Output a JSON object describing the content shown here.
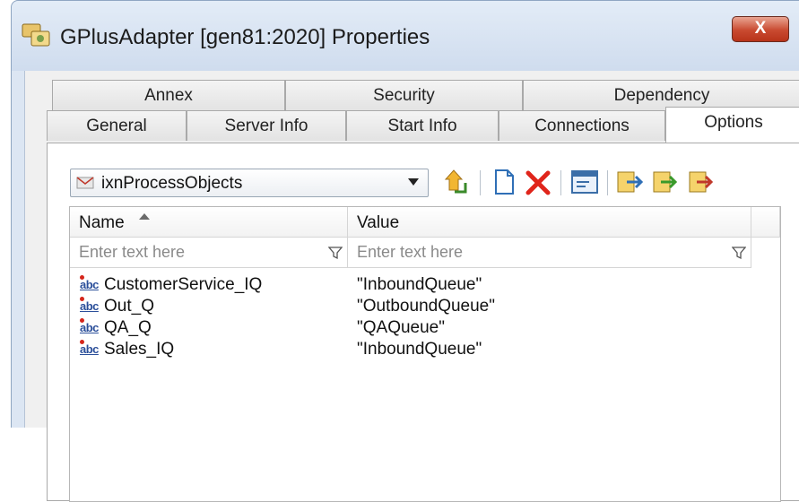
{
  "window": {
    "title": "GPlusAdapter [gen81:2020] Properties",
    "close_glyph": "X",
    "close_color": "#c94a30"
  },
  "tabs": {
    "row1": [
      {
        "label": "Annex"
      },
      {
        "label": "Security"
      },
      {
        "label": "Dependency"
      }
    ],
    "row2": [
      {
        "label": "General"
      },
      {
        "label": "Server Info"
      },
      {
        "label": "Start Info"
      },
      {
        "label": "Connections"
      },
      {
        "label": "Options",
        "active": true
      }
    ]
  },
  "options": {
    "section_selector": {
      "value": "ixnProcessObjects",
      "icon": "section-icon"
    },
    "toolbar": [
      {
        "name": "up-level-icon"
      },
      {
        "name": "new-icon"
      },
      {
        "name": "delete-icon"
      },
      {
        "name": "edit-icon"
      },
      {
        "name": "import-icon"
      },
      {
        "name": "export-icon"
      },
      {
        "name": "copy-icon"
      }
    ],
    "grid": {
      "columns": [
        "Name",
        "Value"
      ],
      "sort_column": "Name",
      "filter_placeholder": "Enter text here",
      "rows": [
        {
          "name": "CustomerService_IQ",
          "value": "\"InboundQueue\"",
          "type_icon": "abc"
        },
        {
          "name": "Out_Q",
          "value": "\"OutboundQueue\"",
          "type_icon": "abc"
        },
        {
          "name": "QA_Q",
          "value": "\"QAQueue\"",
          "type_icon": "abc"
        },
        {
          "name": "Sales_IQ",
          "value": "\"InboundQueue\"",
          "type_icon": "abc"
        }
      ]
    }
  }
}
